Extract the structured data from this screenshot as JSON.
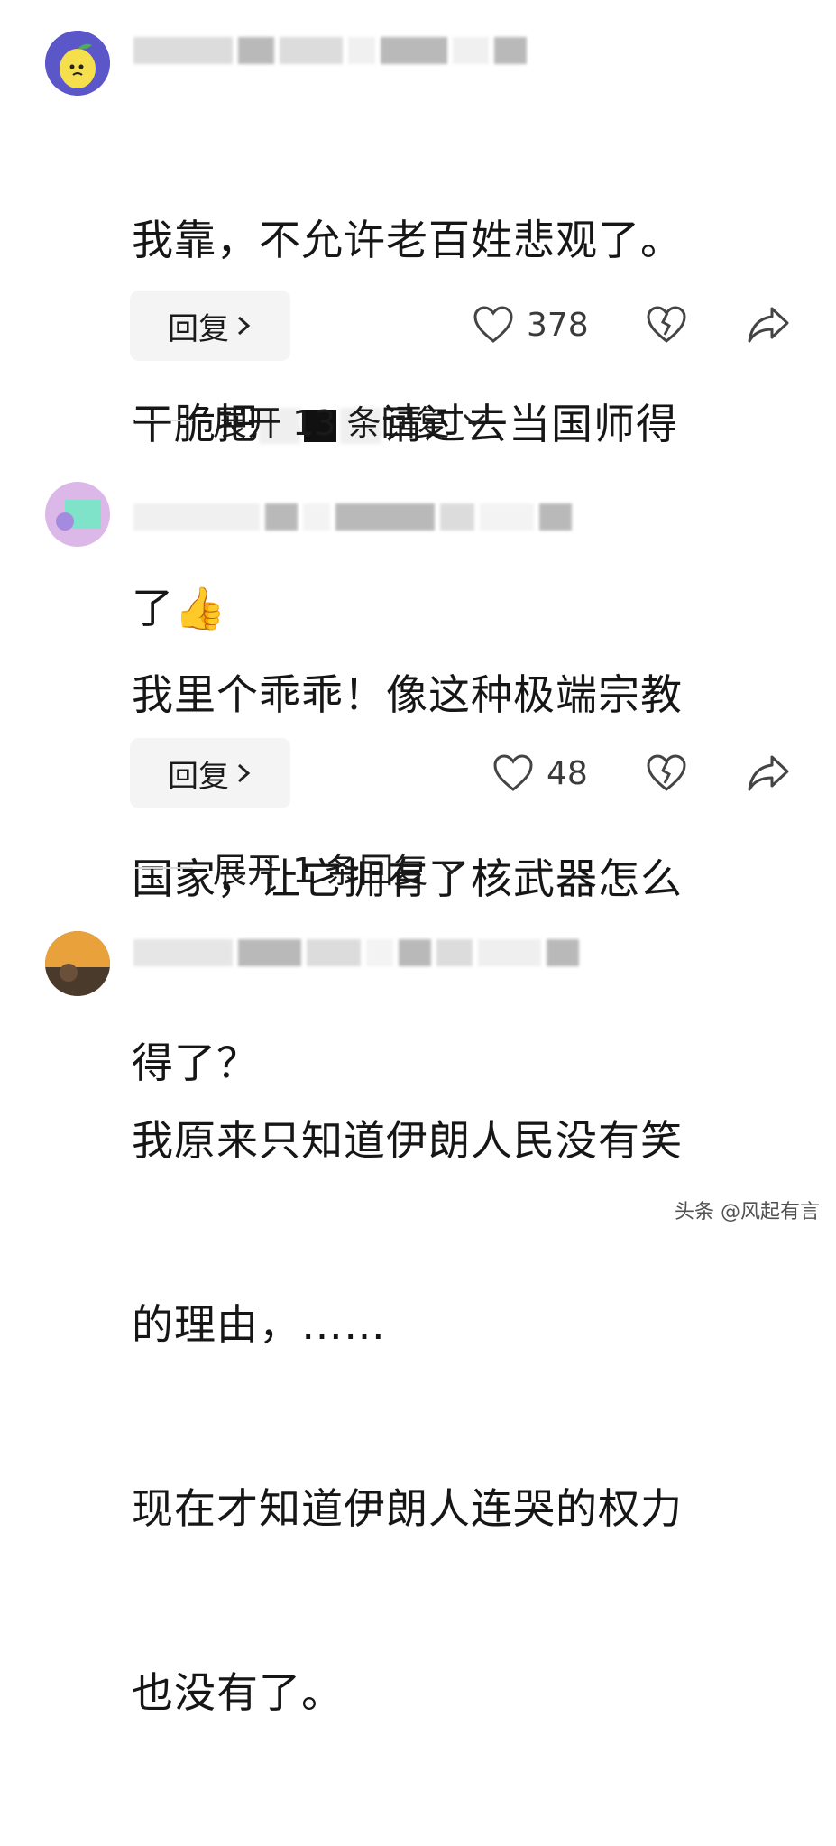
{
  "comments": [
    {
      "text_lines": [
        "我靠，不允许老百姓悲观了。",
        "干脆把",
        "请过去当国师得",
        "了👍"
      ],
      "reply_label": "回复",
      "like_count": "378",
      "expand_label": "展开 13 条回复"
    },
    {
      "text_lines": [
        "我里个乖乖！像这种极端宗教",
        "国家，让它拥有了核武器怎么",
        "得了？"
      ],
      "reply_label": "回复",
      "like_count": "48",
      "expand_label": "展开 1 条回复"
    },
    {
      "text_lines": [
        "我原来只知道伊朗人民没有笑",
        "的理由，……",
        "现在才知道伊朗人连哭的权力",
        "也没有了。"
      ]
    }
  ],
  "watermark": "头条 @风起有言",
  "icons": [
    "heart-icon",
    "dislike-icon",
    "share-icon",
    "chevron-right-icon",
    "chevron-down-icon"
  ]
}
